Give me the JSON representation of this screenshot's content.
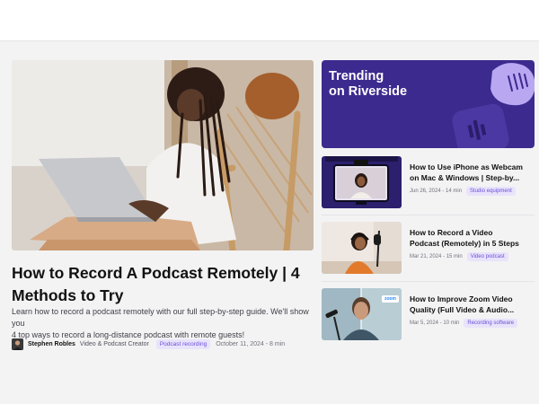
{
  "featured": {
    "title_line1": "How to Record A Podcast Remotely | 4",
    "title_line2": "Methods to Try",
    "excerpt_line1": "Learn how to record a podcast remotely with our full step-by-step guide. We'll show you",
    "excerpt_line2": "4 top ways to record a long-distance podcast with remote guests!",
    "author": "Stephen Robles",
    "role": "Video & Podcast Creator",
    "tag": "Podcast recording",
    "date": "October 11, 2024 - 8 min"
  },
  "trending": {
    "line1": "Trending",
    "line2": "on Riverside"
  },
  "articles": [
    {
      "title_line1": "How to Use iPhone as Webcam",
      "title_line2": "on Mac & Windows | Step-by...",
      "date": "Jun 26, 2024 - 14 min",
      "tag": "Studio equipment"
    },
    {
      "title_line1": "How to Record a Video",
      "title_line2": "Podcast (Remotely) in 5 Steps",
      "date": "Mar 21, 2024 - 15 min",
      "tag": "Video podcast"
    },
    {
      "title_line1": "How to Improve Zoom Video",
      "title_line2": "Quality (Full Video & Audio...",
      "date": "Mar 5, 2024 - 10 min",
      "tag": "Recording software",
      "thumb_badge": "zoom"
    }
  ],
  "colors": {
    "brand_purple": "#3c2a8e",
    "tag_bg": "#e9e3fb",
    "tag_text": "#6b4fd8"
  }
}
